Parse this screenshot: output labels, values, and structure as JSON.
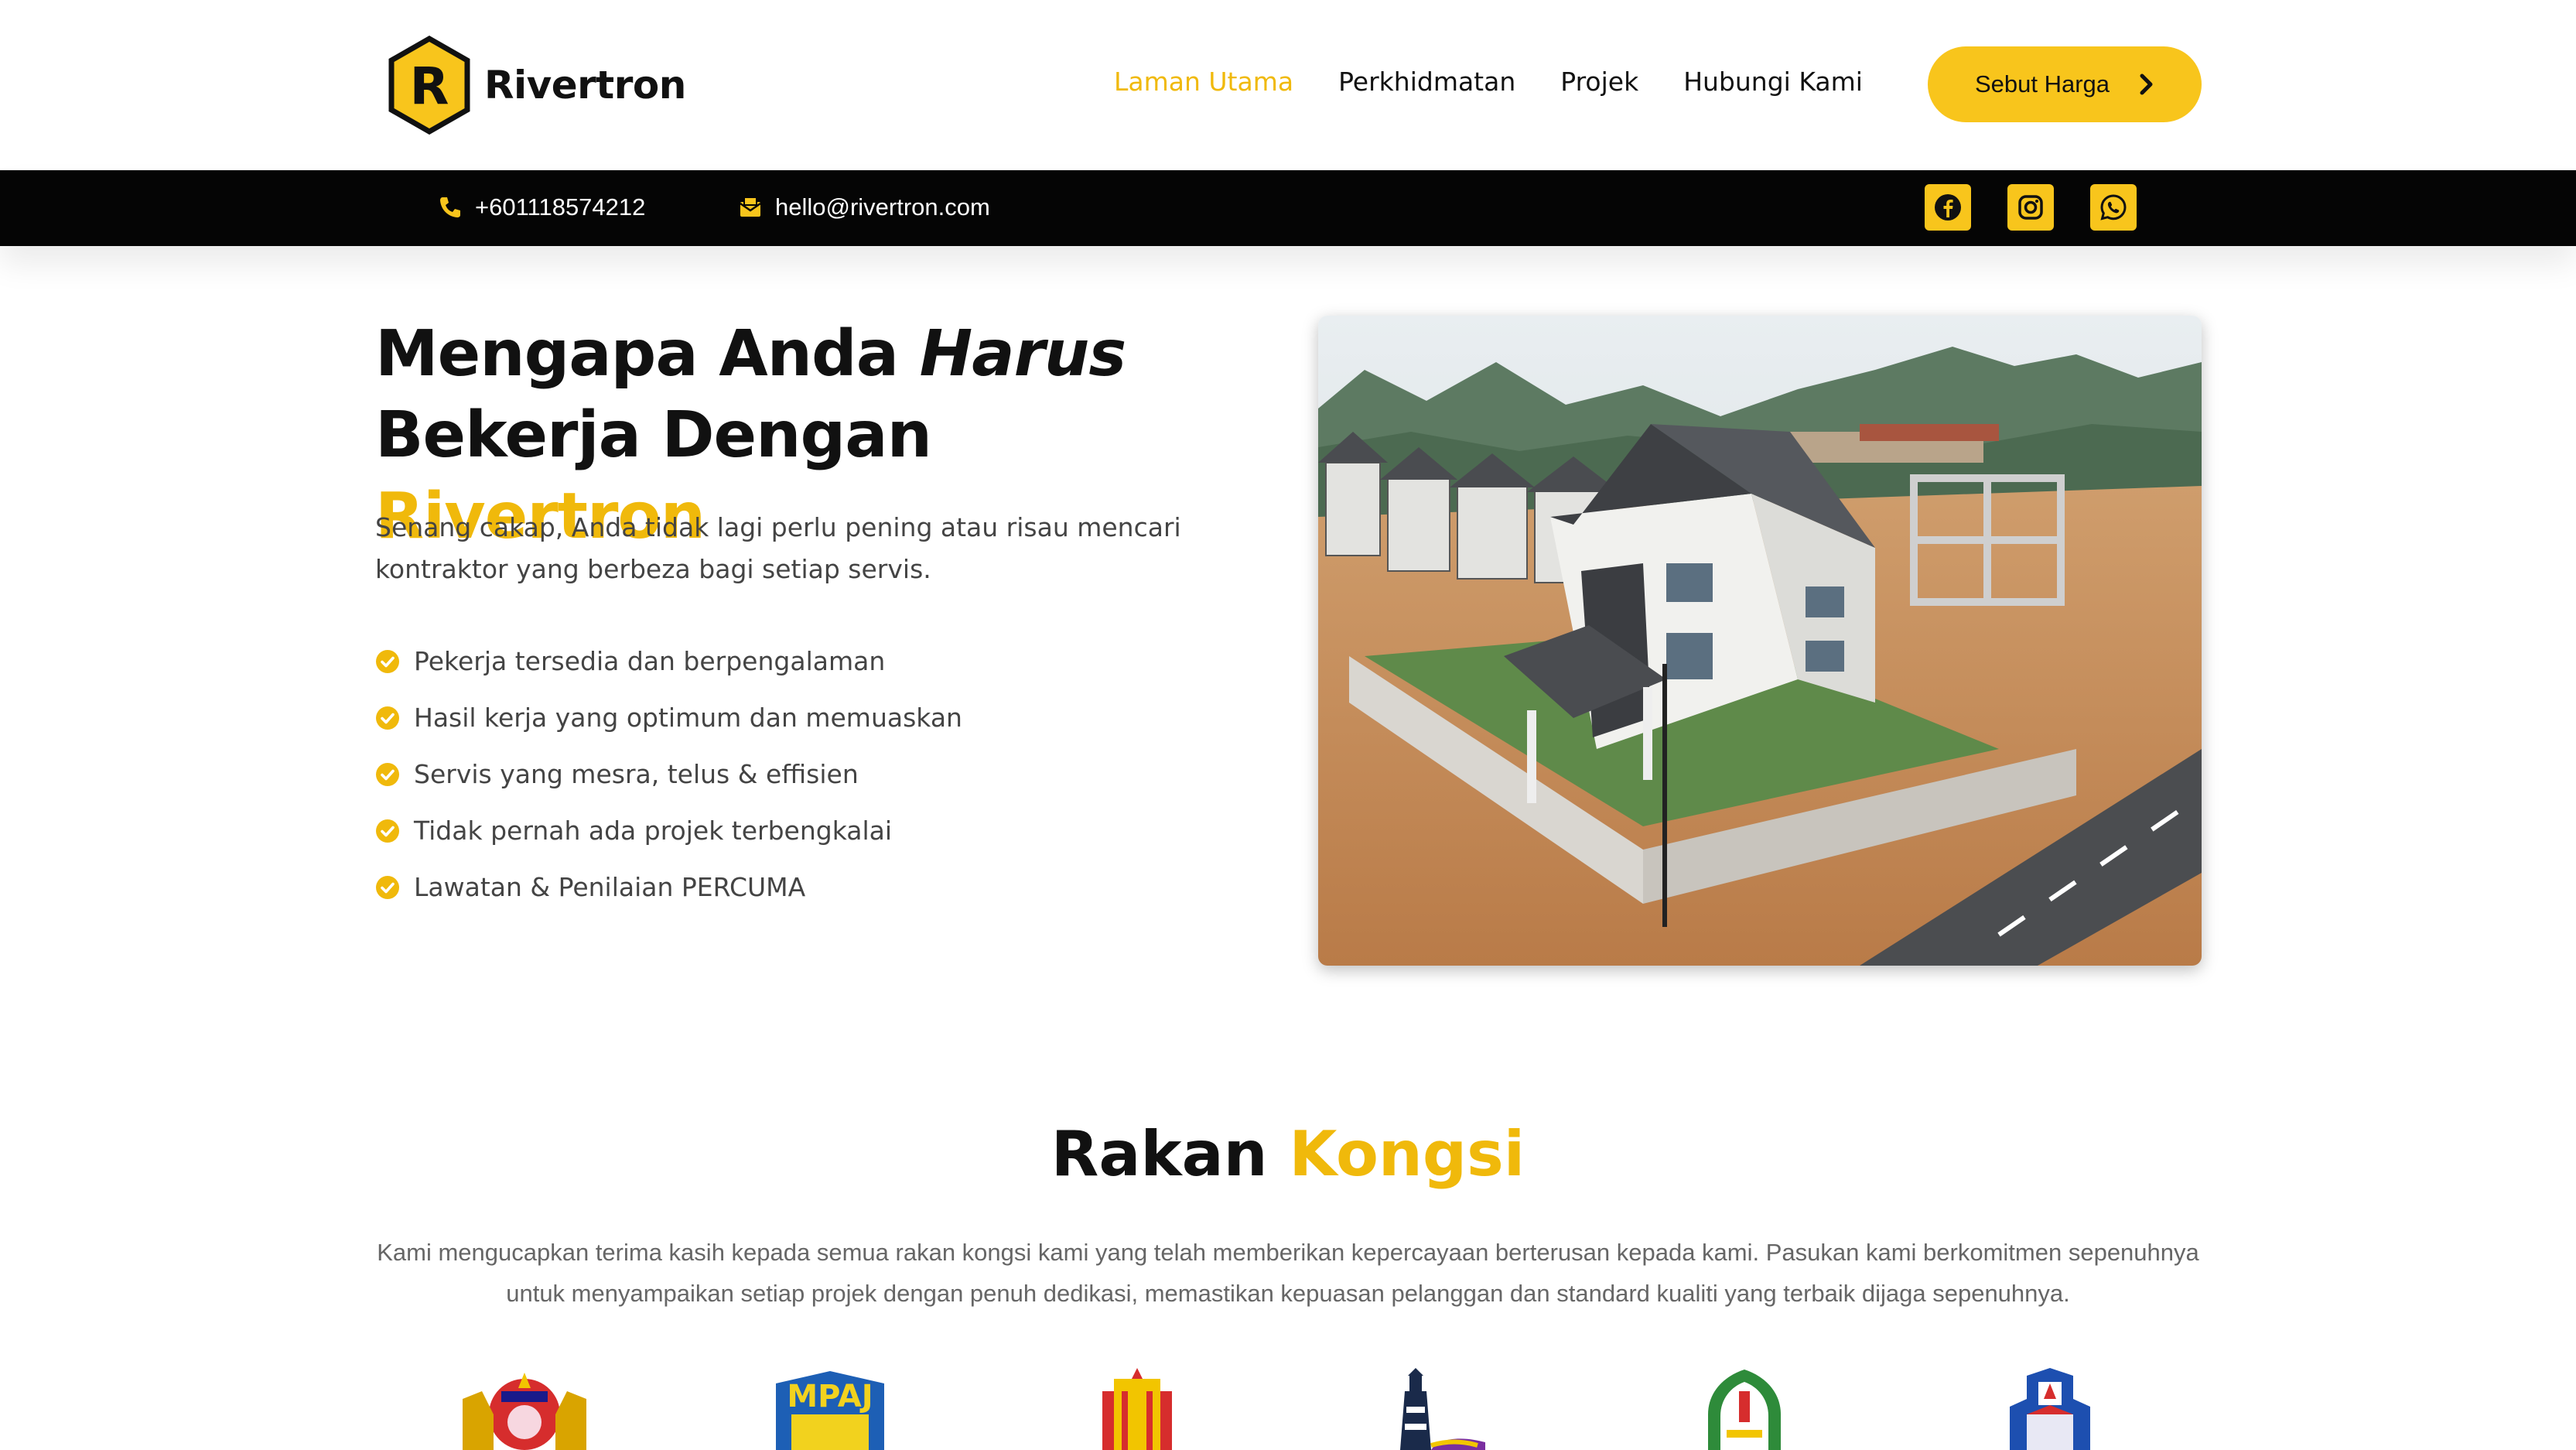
{
  "brand": {
    "letter": "R",
    "name": "Rivertron"
  },
  "nav": {
    "items": [
      {
        "label": "Laman Utama",
        "active": true
      },
      {
        "label": "Perkhidmatan",
        "active": false
      },
      {
        "label": "Projek",
        "active": false
      },
      {
        "label": "Hubungi Kami",
        "active": false
      }
    ],
    "cta": "Sebut Harga"
  },
  "topbar": {
    "phone": "+601118574212",
    "email": "hello@rivertron.com",
    "socials": [
      "facebook-icon",
      "instagram-icon",
      "whatsapp-icon"
    ]
  },
  "hero": {
    "title_part1": "Mengapa Anda ",
    "title_italic": "Harus",
    "title_part2": "Bekerja Dengan ",
    "title_highlight": "Rivertron",
    "description": "Senang cakap, Anda tidak lagi perlu pening atau risau mencari kontraktor yang berbeza bagi setiap servis.",
    "checklist": [
      "Pekerja tersedia dan berpengalaman",
      "Hasil kerja yang optimum dan memuaskan",
      "Servis yang mesra, telus & effisien",
      "Tidak pernah ada projek terbengkalai",
      "Lawatan & Penilaian PERCUMA"
    ]
  },
  "partners": {
    "title_part1": "Rakan ",
    "title_highlight": "Kongsi",
    "description": "Kami mengucapkan terima kasih kepada semua rakan kongsi kami yang telah memberikan kepercayaan berterusan kepada kami. Pasukan kami berkomitmen sepenuhnya untuk menyampaikan setiap projek dengan penuh dedikasi, memastikan kepuasan pelanggan dan standard kualiti yang terbaik dijaga sepenuhnya.",
    "logo_texts": [
      "MPAJ"
    ]
  },
  "colors": {
    "accent": "#F8C51C",
    "accent_text": "#F0B90B",
    "dark": "#050505"
  }
}
